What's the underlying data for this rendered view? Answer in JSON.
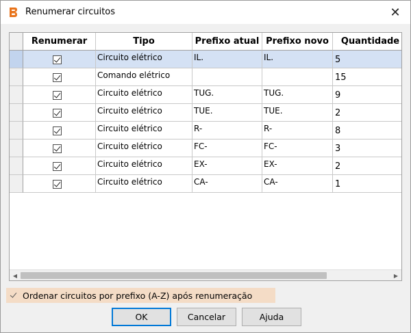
{
  "window": {
    "title": "Renumerar circuitos",
    "close_glyph": "✕",
    "icon": "app-logo-icon"
  },
  "grid": {
    "columns": [
      "Renumerar",
      "Tipo",
      "Prefixo atual",
      "Prefixo novo",
      "Quantidade"
    ],
    "rows": [
      {
        "renumerar": true,
        "tipo": "Circuito elétrico",
        "prefixo_atual": "IL.",
        "prefixo_novo": "IL.",
        "quantidade": "5",
        "selected": true
      },
      {
        "renumerar": true,
        "tipo": "Comando elétrico",
        "prefixo_atual": "",
        "prefixo_novo": "",
        "quantidade": "15",
        "selected": false
      },
      {
        "renumerar": true,
        "tipo": "Circuito elétrico",
        "prefixo_atual": "TUG.",
        "prefixo_novo": "TUG.",
        "quantidade": "9",
        "selected": false
      },
      {
        "renumerar": true,
        "tipo": "Circuito elétrico",
        "prefixo_atual": "TUE.",
        "prefixo_novo": "TUE.",
        "quantidade": "2",
        "selected": false
      },
      {
        "renumerar": true,
        "tipo": "Circuito elétrico",
        "prefixo_atual": "R-",
        "prefixo_novo": "R-",
        "quantidade": "8",
        "selected": false
      },
      {
        "renumerar": true,
        "tipo": "Circuito elétrico",
        "prefixo_atual": "FC-",
        "prefixo_novo": "FC-",
        "quantidade": "3",
        "selected": false
      },
      {
        "renumerar": true,
        "tipo": "Circuito elétrico",
        "prefixo_atual": "EX-",
        "prefixo_novo": "EX-",
        "quantidade": "2",
        "selected": false
      },
      {
        "renumerar": true,
        "tipo": "Circuito elétrico",
        "prefixo_atual": "CA-",
        "prefixo_novo": "CA-",
        "quantidade": "1",
        "selected": false
      }
    ],
    "scroll_left_glyph": "◀",
    "scroll_right_glyph": "▶"
  },
  "options": {
    "sort_label": "Ordenar circuitos por prefixo (A-Z) após renumeração",
    "sort_checked": true
  },
  "buttons": {
    "ok": "OK",
    "cancel": "Cancelar",
    "help": "Ajuda"
  },
  "colors": {
    "selected_row": "#d4e1f4",
    "option_highlight": "#f4dcc6",
    "logo_orange": "#e8731a",
    "default_button_border": "#0078d7"
  }
}
